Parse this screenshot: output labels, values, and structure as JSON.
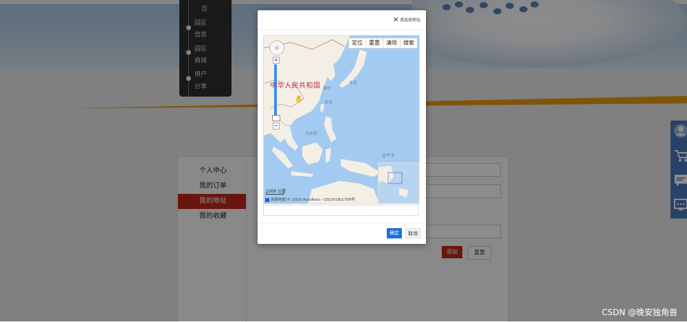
{
  "nav": {
    "items": [
      "页",
      "园区",
      "信息",
      "园区",
      "商城",
      "用户",
      "分享"
    ]
  },
  "user_menu": {
    "items": [
      "个人中心",
      "我的订单",
      "我的地址",
      "我的收藏"
    ],
    "active_index": 2
  },
  "address_form": {
    "add_label": "添加",
    "reset_label": "重置"
  },
  "modal": {
    "title": "请选择地址",
    "close_icon": "close-icon",
    "ok_label": "确定",
    "cancel_label": "取消",
    "address_value": ""
  },
  "map": {
    "toolbar": [
      "定位",
      "重置",
      "清除",
      "搜索"
    ],
    "country_label": "中华人民共和国",
    "scale_label": "1000 公里",
    "copyright_text": "高德地图 © 2020 AutoNavi - GS(2018)1709号",
    "city_labels": [
      "首尔",
      "东京",
      "台北",
      "马尼拉",
      "太平洋"
    ]
  },
  "right_sidebar": {
    "icons": [
      "user-icon",
      "cart-icon",
      "message-icon",
      "chat-icon"
    ]
  },
  "watermark": "CSDN @晚安独角兽",
  "colors": {
    "accent_red": "#c0281a",
    "primary_blue": "#1e6fe0",
    "sidebar_blue": "#4a78bd",
    "stripe_orange": "#e89b12"
  }
}
